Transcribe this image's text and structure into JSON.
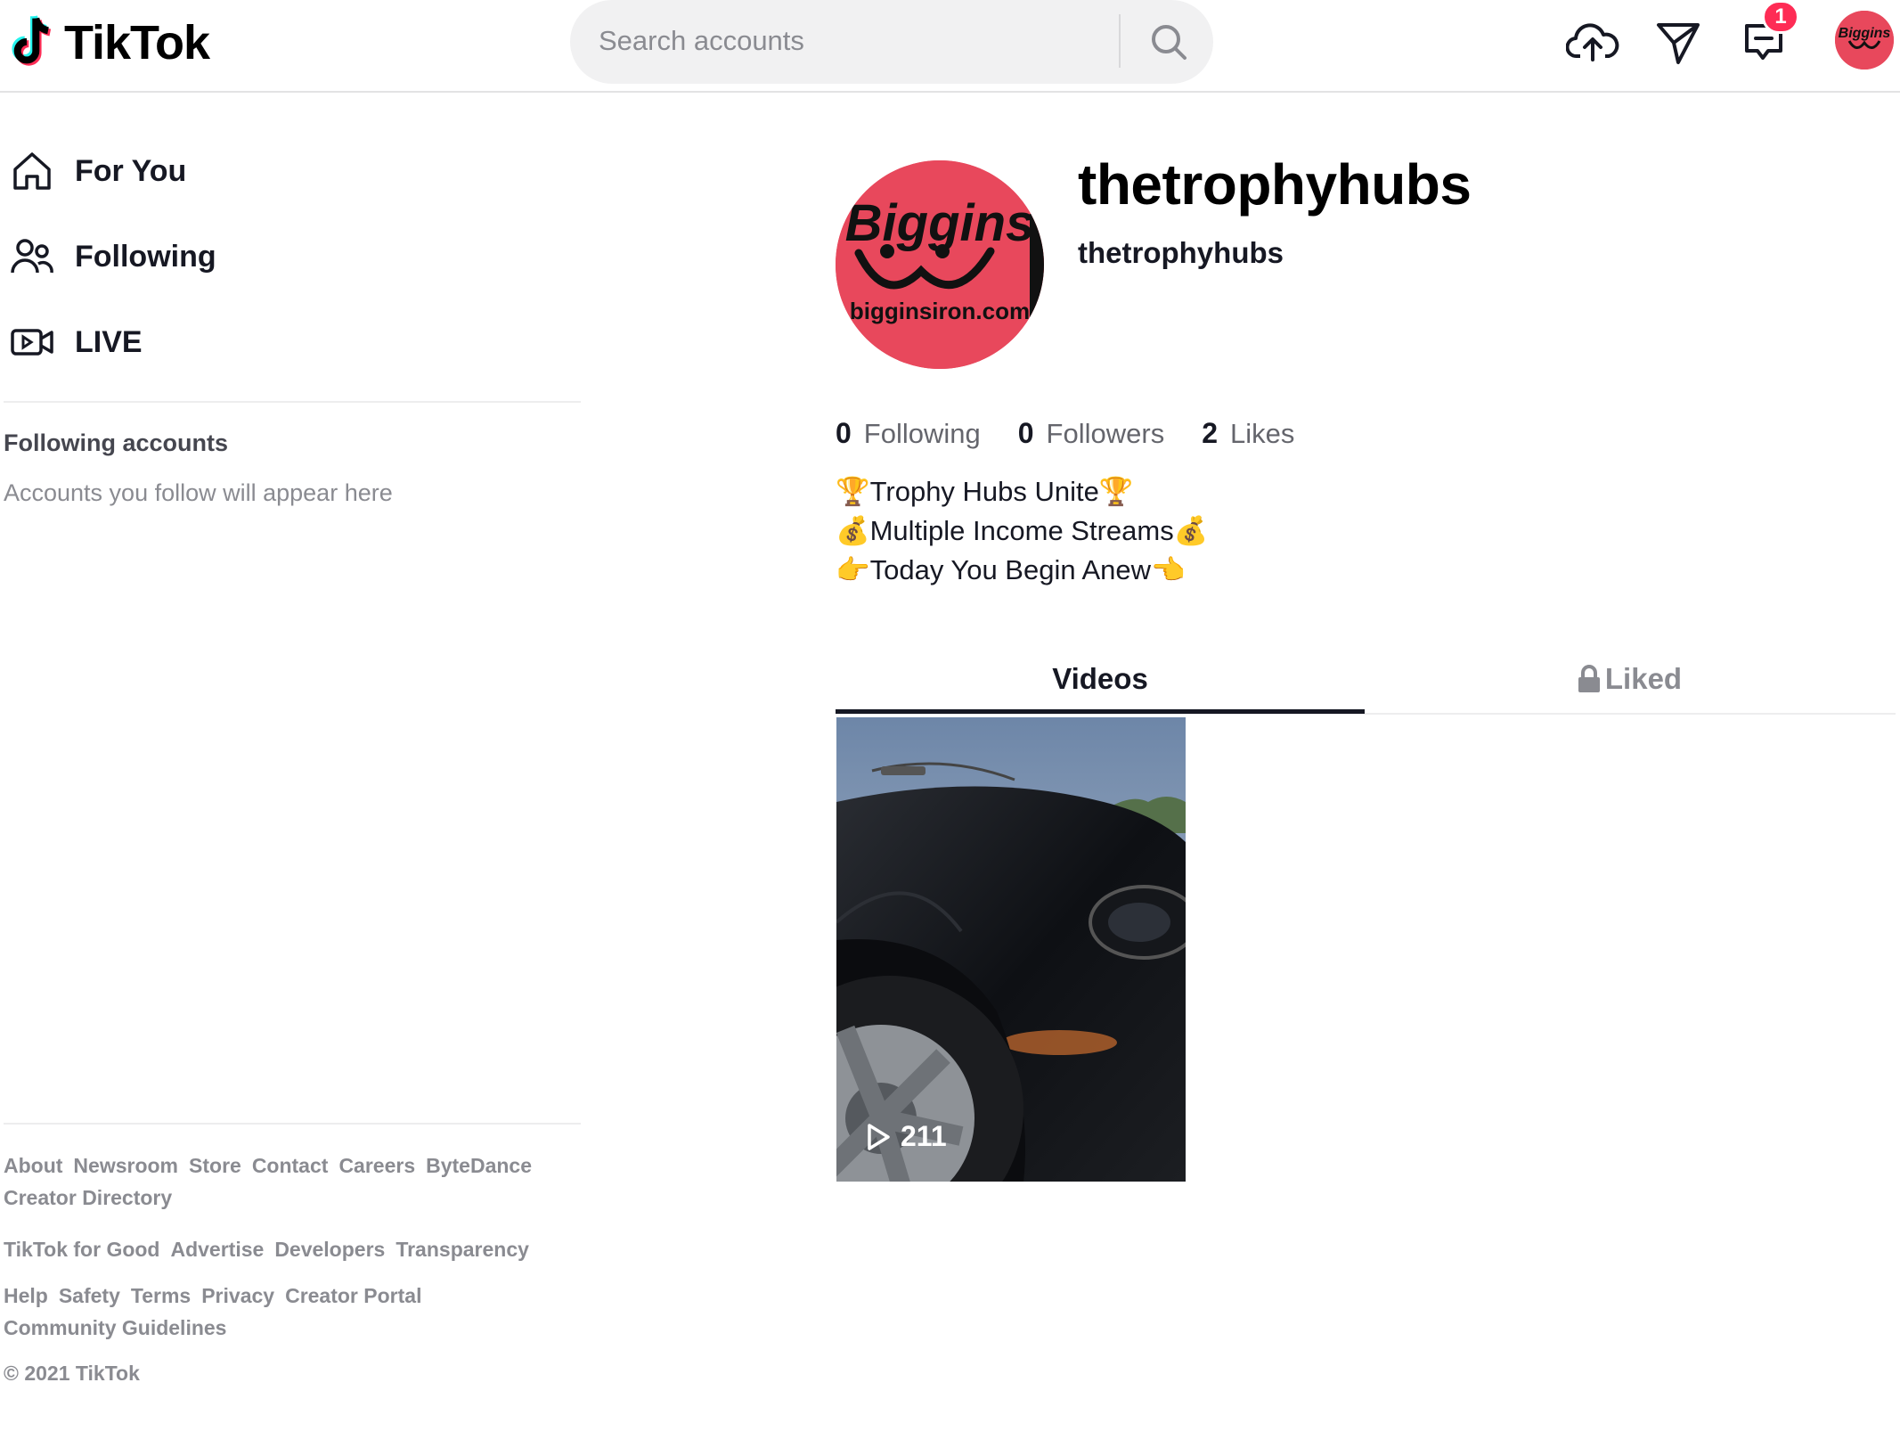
{
  "brand": {
    "name": "TikTok"
  },
  "search": {
    "placeholder": "Search accounts"
  },
  "header": {
    "notification_count": "1"
  },
  "sidebar": {
    "nav": [
      {
        "label": "For You",
        "icon": "home-icon"
      },
      {
        "label": "Following",
        "icon": "users-icon"
      },
      {
        "label": "LIVE",
        "icon": "live-video-icon"
      }
    ],
    "following_title": "Following accounts",
    "following_empty": "Accounts you follow will appear here"
  },
  "footer": {
    "row1": [
      "About",
      "Newsroom",
      "Store",
      "Contact",
      "Careers",
      "ByteDance",
      "Creator Directory"
    ],
    "row2": [
      "TikTok for Good",
      "Advertise",
      "Developers",
      "Transparency"
    ],
    "row3": [
      "Help",
      "Safety",
      "Terms",
      "Privacy",
      "Creator Portal",
      "Community Guidelines"
    ],
    "copyright": "© 2021 TikTok"
  },
  "profile": {
    "title": "thetrophyhubs",
    "subtitle": "thetrophyhubs",
    "avatar_text_top": "Biggins",
    "avatar_text_bottom": "bigginsiron.com",
    "stats": {
      "following_count": "0",
      "following_label": "Following",
      "followers_count": "0",
      "followers_label": "Followers",
      "likes_count": "2",
      "likes_label": "Likes"
    },
    "bio": [
      "🏆Trophy Hubs Unite🏆",
      "💰Multiple Income Streams💰",
      "👉Today You Begin Anew👈"
    ]
  },
  "tabs": {
    "videos": "Videos",
    "liked": "Liked"
  },
  "videos": [
    {
      "views": "211"
    }
  ],
  "colors": {
    "accent": "#fe2c55",
    "text": "#161823",
    "muted": "#8a8b91",
    "avatar": "#e8485c"
  }
}
